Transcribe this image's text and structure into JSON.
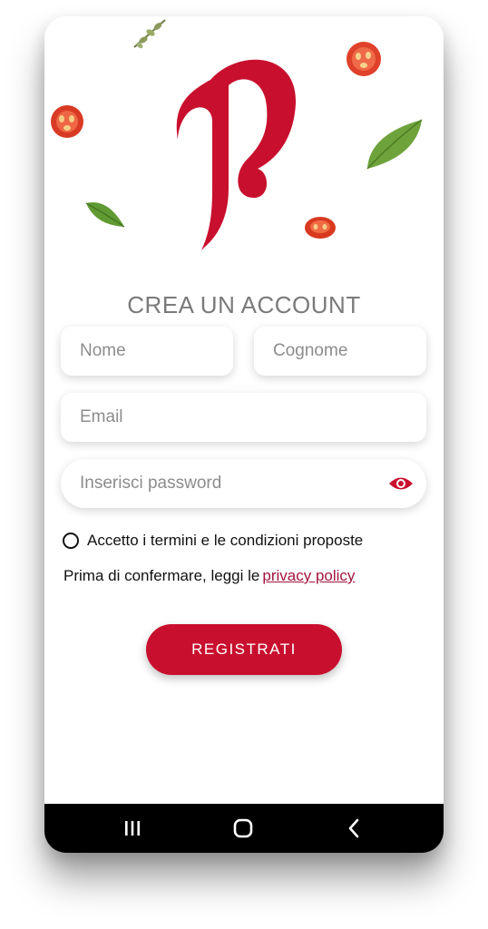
{
  "brand": {
    "accent": "#c8102e",
    "link_color": "#a3153c"
  },
  "header": {
    "title": "CREA UN ACCOUNT"
  },
  "form": {
    "nome_placeholder": "Nome",
    "cognome_placeholder": "Cognome",
    "email_placeholder": "Email",
    "password_placeholder": "Inserisci password",
    "password_toggle_icon": "eye-icon"
  },
  "terms": {
    "label": "Accetto i termini e le condizioni proposte",
    "checked": false
  },
  "privacy": {
    "prefix": "Prima di confermare, leggi le",
    "link_label": "privacy policy"
  },
  "actions": {
    "register_label": "REGISTRATI"
  },
  "navbar": {
    "icons": [
      "recent-apps-icon",
      "home-icon",
      "back-icon"
    ]
  }
}
